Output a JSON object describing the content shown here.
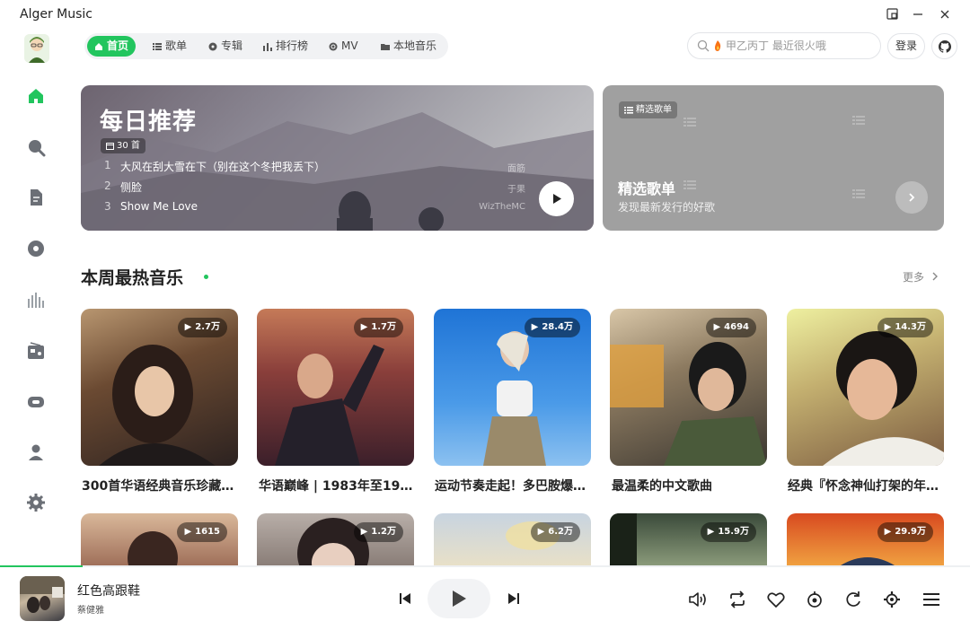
{
  "app": {
    "title": "Alger Music"
  },
  "nav": {
    "tabs": [
      {
        "label": "首页",
        "icon": "home-icon",
        "active": true
      },
      {
        "label": "歌单",
        "icon": "list-icon",
        "active": false
      },
      {
        "label": "专辑",
        "icon": "disc-icon",
        "active": false
      },
      {
        "label": "排行榜",
        "icon": "chart-icon",
        "active": false
      },
      {
        "label": "MV",
        "icon": "mv-icon",
        "active": false
      },
      {
        "label": "本地音乐",
        "icon": "folder-icon",
        "active": false
      }
    ]
  },
  "search": {
    "placeholder": "甲乙丙丁 最近很火哦"
  },
  "header": {
    "login_label": "登录"
  },
  "daily": {
    "title": "每日推荐",
    "count": "30 首",
    "tracks": [
      {
        "num": "1",
        "name": "大风在刮大雪在下（别在这个冬把我丢下）",
        "artist": "面筋"
      },
      {
        "num": "2",
        "name": "侧脸",
        "artist": "于果"
      },
      {
        "num": "3",
        "name": "Show Me Love",
        "artist": "WizTheMC"
      }
    ]
  },
  "picked": {
    "badge": "精选歌单",
    "title": "精选歌单",
    "subtitle": "发现最新发行的好歌"
  },
  "section": {
    "title": "本周最热音乐",
    "more_label": "更多"
  },
  "playlists_row1": [
    {
      "title": "300首华语经典音乐珍藏…",
      "plays": "2.7万"
    },
    {
      "title": "华语巅峰 | 1983年至199…",
      "plays": "1.7万"
    },
    {
      "title": "运动节奏走起！多巴胺爆…",
      "plays": "28.4万"
    },
    {
      "title": "最温柔的中文歌曲",
      "plays": "4694"
    },
    {
      "title": "经典『怀念神仙打架的年…",
      "plays": "14.3万"
    }
  ],
  "playlists_row2": [
    {
      "plays": "1615"
    },
    {
      "plays": "1.2万"
    },
    {
      "plays": "6.2万"
    },
    {
      "plays": "15.9万"
    },
    {
      "plays": "29.9万"
    }
  ],
  "player": {
    "song": "红色高跟鞋",
    "artist": "蔡健雅",
    "progress": 0.085
  },
  "colors": {
    "accent": "#22c55e"
  }
}
